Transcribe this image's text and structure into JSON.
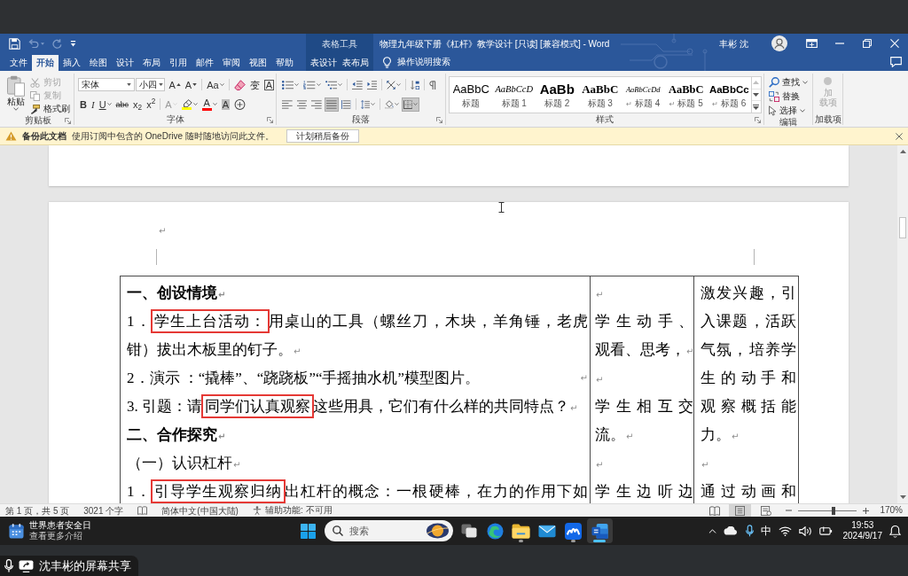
{
  "window": {
    "tool_group": "表格工具",
    "title": "物理九年级下册《杠杆》教学设计 [只读] [兼容模式] - Word",
    "user": "丰彬 沈"
  },
  "quick_access": [
    {
      "kind": "save",
      "disabled": false
    },
    {
      "kind": "undo",
      "disabled": true
    },
    {
      "kind": "redo",
      "disabled": true
    },
    {
      "kind": "customize",
      "disabled": false
    }
  ],
  "tabs": [
    {
      "label": "文件",
      "selected": false,
      "contextual": false
    },
    {
      "label": "开始",
      "selected": true,
      "contextual": false
    },
    {
      "label": "插入",
      "selected": false,
      "contextual": false
    },
    {
      "label": "绘图",
      "selected": false,
      "contextual": false
    },
    {
      "label": "设计",
      "selected": false,
      "contextual": false
    },
    {
      "label": "布局",
      "selected": false,
      "contextual": false
    },
    {
      "label": "引用",
      "selected": false,
      "contextual": false
    },
    {
      "label": "邮件",
      "selected": false,
      "contextual": false
    },
    {
      "label": "审阅",
      "selected": false,
      "contextual": false
    },
    {
      "label": "视图",
      "selected": false,
      "contextual": false
    },
    {
      "label": "帮助",
      "selected": false,
      "contextual": false
    },
    {
      "label": "表设计",
      "selected": false,
      "contextual": true
    },
    {
      "label": "表布局",
      "selected": false,
      "contextual": true
    }
  ],
  "tell_me": {
    "label": "操作说明搜索"
  },
  "ribbon": {
    "clipboard": {
      "title": "剪贴板",
      "paste": {
        "label": "粘贴"
      },
      "tools": [
        {
          "kind": "cut",
          "label": "剪切",
          "disabled": true
        },
        {
          "kind": "copy",
          "label": "复制",
          "disabled": true
        },
        {
          "kind": "format-painter",
          "label": "格式刷",
          "disabled": false
        }
      ]
    },
    "font": {
      "title": "字体",
      "font_name": "宋体",
      "font_size": "小四",
      "row_1": [
        {
          "kind": "grow",
          "glyph": "A",
          "disabled": false
        },
        {
          "kind": "shrink",
          "glyph": "A",
          "disabled": false
        },
        {
          "kind": "case",
          "glyph": "Aa",
          "disabled": false
        },
        {
          "kind": "clear",
          "disabled": false
        },
        {
          "kind": "phonetic",
          "glyph": "变",
          "disabled": false
        },
        {
          "kind": "border",
          "glyph": "A",
          "disabled": false
        }
      ],
      "row_2": [
        {
          "kind": "bold",
          "glyph": "B",
          "disabled": false
        },
        {
          "kind": "italic",
          "glyph": "I",
          "disabled": false
        },
        {
          "kind": "underline",
          "glyph": "U",
          "disabled": false
        },
        {
          "kind": "strike",
          "glyph": "abc",
          "disabled": false
        },
        {
          "kind": "sub",
          "glyph": "x$_{2}$",
          "disabled": false
        },
        {
          "kind": "sup",
          "glyph": "x$^{2}$",
          "disabled": false
        },
        {
          "kind": "effects",
          "glyph": "A",
          "disabled": true
        },
        {
          "kind": "highlight",
          "color": "#ffff00",
          "disabled": false
        },
        {
          "kind": "color",
          "glyph": "A",
          "color": "#ff0000",
          "disabled": false
        },
        {
          "kind": "shading",
          "glyph": "A",
          "disabled": false
        },
        {
          "kind": "enclose",
          "disabled": false
        }
      ]
    },
    "paragraph": {
      "title": "段落",
      "row_1": [
        {
          "kind": "bullets",
          "selected": false
        },
        {
          "kind": "numbering",
          "selected": false
        },
        {
          "kind": "multilevel",
          "selected": false
        },
        {
          "kind": "outdent",
          "selected": false
        },
        {
          "kind": "indent",
          "selected": false
        },
        {
          "kind": "asian-layout",
          "selected": false
        },
        {
          "kind": "sort",
          "selected": false
        },
        {
          "kind": "marks",
          "selected": false
        }
      ],
      "row_2": [
        {
          "kind": "align-left",
          "selected": false
        },
        {
          "kind": "align-center",
          "selected": false
        },
        {
          "kind": "align-right",
          "selected": false
        },
        {
          "kind": "justify",
          "selected": true
        },
        {
          "kind": "distribute",
          "selected": false
        },
        {
          "kind": "line-spacing",
          "selected": false
        },
        {
          "kind": "shading",
          "selected": false
        },
        {
          "kind": "borders",
          "selected": true
        }
      ]
    },
    "styles": {
      "title": "样式",
      "items": [
        {
          "kind": "title",
          "preview": "AaBbC",
          "label": "标题"
        },
        {
          "kind": "italic",
          "preview": "AaBbCcD",
          "label": "标题 1"
        },
        {
          "kind": "heavy",
          "preview": "AaBb",
          "label": "标题 2"
        },
        {
          "kind": "bold",
          "preview": "AaBbC",
          "label": "标题 3"
        },
        {
          "kind": "small-italic",
          "preview": "AaBbCcDd",
          "label": "标题 4",
          "link_mark": "↵"
        },
        {
          "kind": "bold-serif",
          "preview": "AaBbC",
          "label": "标题 5",
          "link_mark": "↵"
        },
        {
          "kind": "bold-sans",
          "preview": "AaBbCc",
          "label": "标题 6",
          "link_mark": "↵"
        }
      ]
    },
    "editing": {
      "title": "编辑",
      "items": [
        {
          "kind": "find",
          "label": "查找",
          "dropdown": true
        },
        {
          "kind": "replace",
          "label": "替换",
          "dropdown": false
        },
        {
          "kind": "select",
          "label": "选择",
          "dropdown": true
        }
      ]
    },
    "add_ins": {
      "title": "加载项",
      "label_lines": [
        "加",
        "载项"
      ],
      "disabled": true
    }
  },
  "info_bar": {
    "title": "备份此文档",
    "message": "使用订阅中包含的 OneDrive 随时随地访问此文件。",
    "button": "计划稍后备份"
  },
  "document": {
    "lead_paragraphs": [
      {
        "end_mark": "↵"
      }
    ],
    "table": {
      "rows": [
        {
          "cells": [
            {
              "paragraphs": [
                {
                  "bold": true,
                  "lines": [
                    [
                      {
                        "text": "一、创设情境",
                        "boxed": false
                      }
                    ]
                  ],
                  "end_mark": "↵"
                },
                {
                  "bold": false,
                  "lines": [
                    [
                      {
                        "text": "1．",
                        "boxed": false
                      },
                      {
                        "text": "学生上台活动：",
                        "boxed": true
                      },
                      {
                        "text": "用桌山的工具（螺丝刀，木块，羊角锤，老虎",
                        "boxed": false
                      }
                    ],
                    [
                      {
                        "text": "钳）拔出木板里的钉子。",
                        "boxed": false
                      }
                    ]
                  ],
                  "end_mark": "↵"
                },
                {
                  "bold": false,
                  "lines": [
                    [
                      {
                        "text": "2．演示 ：“撬棒”、“跷跷板”“手摇抽水机”模型图片。",
                        "boxed": false
                      }
                    ]
                  ],
                  "end_mark": "↵",
                  "mark_at_edge": true
                },
                {
                  "bold": false,
                  "lines": [
                    [
                      {
                        "text": "3. 引题：请",
                        "boxed": false
                      },
                      {
                        "text": "同学们认真观察",
                        "boxed": true
                      },
                      {
                        "text": "这些用具，它们有什么样的共同特点？",
                        "boxed": false
                      }
                    ]
                  ],
                  "end_mark": "↵"
                },
                {
                  "bold": true,
                  "lines": [
                    [
                      {
                        "text": "二、合作探究",
                        "boxed": false
                      }
                    ]
                  ],
                  "end_mark": "↵"
                },
                {
                  "bold": false,
                  "lines": [
                    [
                      {
                        "text": "（一）认识杠杆",
                        "boxed": false
                      }
                    ]
                  ],
                  "end_mark": "↵"
                },
                {
                  "bold": false,
                  "lines": [
                    [
                      {
                        "text": "1．",
                        "boxed": false
                      },
                      {
                        "text": "引导学生观察归纳",
                        "boxed": true
                      },
                      {
                        "text": "出杠杆的概念：一根硬棒，在力的作用下如",
                        "boxed": false
                      }
                    ]
                  ],
                  "continues": true
                }
              ]
            },
            {
              "paragraphs": [
                {
                  "bold": false,
                  "end_mark": "↵"
                },
                {
                  "bold": false,
                  "lines": [
                    [
                      {
                        "text": "学生动手、",
                        "boxed": false
                      }
                    ],
                    [
                      {
                        "text": "观看、思考，",
                        "boxed": false
                      }
                    ]
                  ],
                  "end_mark": "↵"
                },
                {
                  "bold": false,
                  "end_mark": "↵"
                },
                {
                  "bold": false,
                  "lines": [
                    [
                      {
                        "text": "学生相互交",
                        "boxed": false
                      }
                    ],
                    [
                      {
                        "text": "流。",
                        "boxed": false
                      }
                    ]
                  ],
                  "end_mark": "↵"
                },
                {
                  "bold": false,
                  "end_mark": "↵"
                },
                {
                  "bold": false,
                  "lines": [
                    [
                      {
                        "text": "学生边听边",
                        "boxed": false
                      }
                    ]
                  ],
                  "continues": true
                }
              ]
            },
            {
              "paragraphs": [
                {
                  "bold": false,
                  "lines": [
                    [
                      {
                        "text": "激发兴趣，引",
                        "boxed": false
                      }
                    ],
                    [
                      {
                        "text": "入课题，活跃",
                        "boxed": false
                      }
                    ],
                    [
                      {
                        "text": "气氛，培养学",
                        "boxed": false
                      }
                    ],
                    [
                      {
                        "text": "生的动手和",
                        "boxed": false
                      }
                    ],
                    [
                      {
                        "text": "观察概括能",
                        "boxed": false
                      }
                    ],
                    [
                      {
                        "text": "力。",
                        "boxed": false
                      }
                    ]
                  ],
                  "end_mark": "↵"
                },
                {
                  "bold": false,
                  "end_mark": "↵"
                },
                {
                  "bold": false,
                  "lines": [
                    [
                      {
                        "text": "通过动画和",
                        "boxed": false
                      }
                    ]
                  ],
                  "continues": true
                }
              ]
            }
          ]
        }
      ]
    }
  },
  "status_bar": {
    "page": "第 1 页，共 5 页",
    "words": "3021 个字",
    "language": "简体中文(中国大陆)",
    "accessibility": "辅助功能: 不可用",
    "views": [
      {
        "kind": "read",
        "selected": false
      },
      {
        "kind": "print",
        "selected": true
      },
      {
        "kind": "web",
        "selected": false
      }
    ],
    "zoom": {
      "level": 0.6,
      "reading": "170%"
    }
  },
  "taskbar": {
    "widget": {
      "title": "世界患者安全日",
      "subtitle": "查看更多介绍"
    },
    "search": {
      "placeholder": "搜索"
    },
    "apps": [
      {
        "kind": "task-view",
        "running": false,
        "active": false
      },
      {
        "kind": "edge",
        "running": false,
        "active": false
      },
      {
        "kind": "explorer",
        "running": true,
        "active": false
      },
      {
        "kind": "mail",
        "running": false,
        "active": false
      },
      {
        "kind": "meeting",
        "running": true,
        "active": false
      },
      {
        "kind": "word",
        "running": true,
        "active": true
      }
    ],
    "tray": {
      "ime": "中",
      "time": "19:53",
      "date": "2024/9/17"
    }
  },
  "screen_share": {
    "label": "沈丰彬的屏幕共享"
  }
}
